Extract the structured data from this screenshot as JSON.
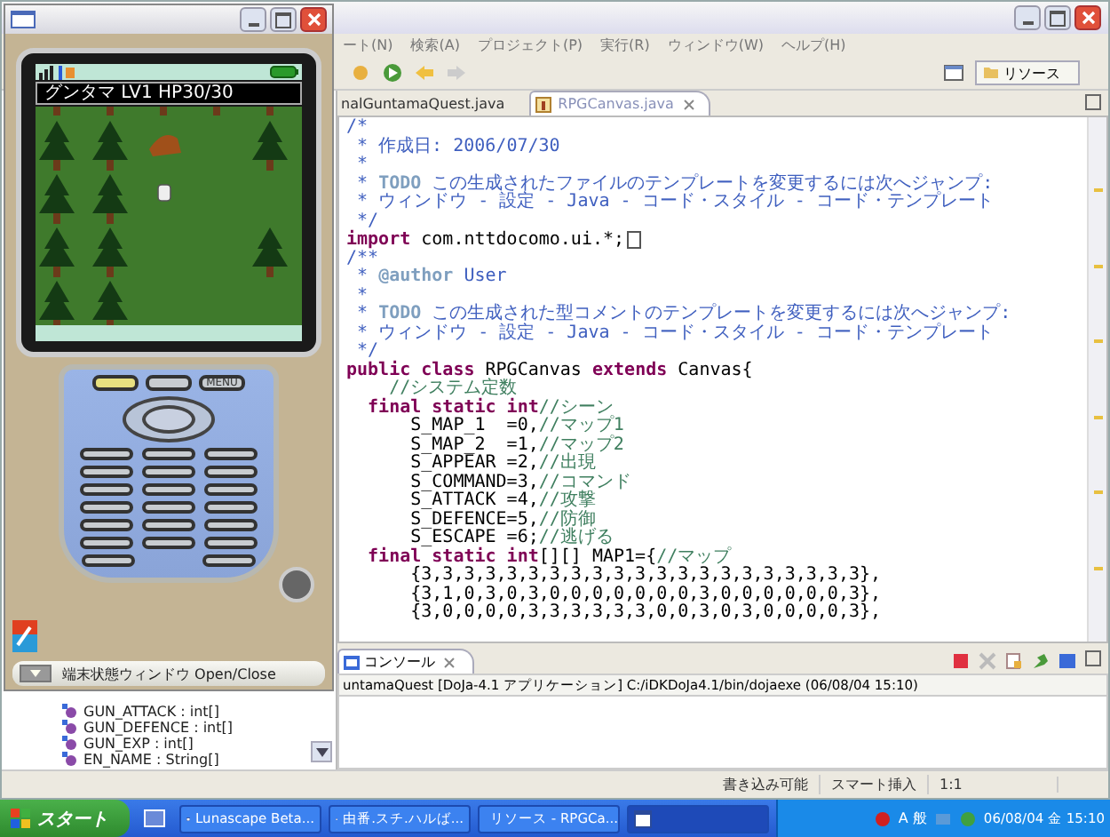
{
  "eclipse": {
    "menu": [
      "ート(N)",
      "検索(A)",
      "プロジェクト(P)",
      "実行(R)",
      "ウィンドウ(W)",
      "ヘルプ(H)"
    ],
    "perspective": "リソース",
    "tabs": [
      {
        "label": "nalGuntamaQuest.java",
        "selected": false
      },
      {
        "label": "RPGCanvas.java",
        "selected": true
      }
    ],
    "code_lines": [
      {
        "parts": [
          {
            "kind": "doc",
            "text": "/*"
          }
        ]
      },
      {
        "parts": [
          {
            "kind": "doc",
            "text": " * 作成日: 2006/07/30"
          }
        ]
      },
      {
        "parts": [
          {
            "kind": "doc",
            "text": " *"
          }
        ]
      },
      {
        "parts": [
          {
            "kind": "doc",
            "text": " * "
          },
          {
            "kind": "tag",
            "text": "TODO"
          },
          {
            "kind": "doc",
            "text": " この生成されたファイルのテンプレートを変更するには次へジャンプ:"
          }
        ]
      },
      {
        "parts": [
          {
            "kind": "doc",
            "text": " * ウィンドウ - 設定 - Java - コード・スタイル - コード・テンプレート"
          }
        ]
      },
      {
        "parts": [
          {
            "kind": "doc",
            "text": " */"
          }
        ]
      },
      {
        "parts": [
          {
            "kind": "keyword",
            "text": "import"
          },
          {
            "kind": "plain",
            "text": " com.nttdocomo.ui.*;"
          }
        ],
        "folded": true
      },
      {
        "parts": [
          {
            "kind": "doc",
            "text": "/**"
          }
        ]
      },
      {
        "parts": [
          {
            "kind": "doc",
            "text": " * "
          },
          {
            "kind": "tag",
            "text": "@author"
          },
          {
            "kind": "doc",
            "text": " User"
          }
        ]
      },
      {
        "parts": [
          {
            "kind": "doc",
            "text": " *"
          }
        ]
      },
      {
        "parts": [
          {
            "kind": "doc",
            "text": " * "
          },
          {
            "kind": "tag",
            "text": "TODO"
          },
          {
            "kind": "doc",
            "text": " この生成された型コメントのテンプレートを変更するには次へジャンプ:"
          }
        ]
      },
      {
        "parts": [
          {
            "kind": "doc",
            "text": " * ウィンドウ - 設定 - Java - コード・スタイル - コード・テンプレート"
          }
        ]
      },
      {
        "parts": [
          {
            "kind": "doc",
            "text": " */"
          }
        ]
      },
      {
        "parts": [
          {
            "kind": "keyword",
            "text": "public class"
          },
          {
            "kind": "plain",
            "text": " RPGCanvas "
          },
          {
            "kind": "keyword",
            "text": "extends"
          },
          {
            "kind": "plain",
            "text": " Canvas{"
          }
        ]
      },
      {
        "parts": [
          {
            "kind": "comment",
            "text": "    //システム定数"
          }
        ]
      },
      {
        "parts": [
          {
            "kind": "keyword",
            "text": "  final static int"
          },
          {
            "kind": "comment",
            "text": "//シーン"
          }
        ]
      },
      {
        "parts": [
          {
            "kind": "plain",
            "text": "      S_MAP_1  =0,"
          },
          {
            "kind": "comment",
            "text": "//マップ1"
          }
        ]
      },
      {
        "parts": [
          {
            "kind": "plain",
            "text": "      S_MAP_2  =1,"
          },
          {
            "kind": "comment",
            "text": "//マップ2"
          }
        ]
      },
      {
        "parts": [
          {
            "kind": "plain",
            "text": "      S_APPEAR =2,"
          },
          {
            "kind": "comment",
            "text": "//出現"
          }
        ]
      },
      {
        "parts": [
          {
            "kind": "plain",
            "text": "      S_COMMAND=3,"
          },
          {
            "kind": "comment",
            "text": "//コマンド"
          }
        ]
      },
      {
        "parts": [
          {
            "kind": "plain",
            "text": "      S_ATTACK =4,"
          },
          {
            "kind": "comment",
            "text": "//攻撃"
          }
        ]
      },
      {
        "parts": [
          {
            "kind": "plain",
            "text": "      S_DEFENCE=5,"
          },
          {
            "kind": "comment",
            "text": "//防御"
          }
        ]
      },
      {
        "parts": [
          {
            "kind": "plain",
            "text": "      S_ESCAPE =6;"
          },
          {
            "kind": "comment",
            "text": "//逃げる"
          }
        ]
      },
      {
        "parts": [
          {
            "kind": "keyword",
            "text": "  final static int"
          },
          {
            "kind": "plain",
            "text": "[][] MAP1={"
          },
          {
            "kind": "comment",
            "text": "//マップ"
          }
        ]
      },
      {
        "parts": [
          {
            "kind": "plain",
            "text": "      {3,3,3,3,3,3,3,3,3,3,3,3,3,3,3,3,3,3,3,3,3},"
          }
        ]
      },
      {
        "parts": [
          {
            "kind": "plain",
            "text": "      {3,1,0,3,0,3,0,0,0,0,0,0,0,3,0,0,0,0,0,0,3},"
          }
        ]
      },
      {
        "parts": [
          {
            "kind": "plain",
            "text": "      {3,0,0,0,0,3,3,3,3,3,3,0,0,3,0,3,0,0,0,0,3},"
          }
        ]
      }
    ],
    "console": {
      "tab": "コンソール",
      "header": "untamaQuest [DoJa-4.1 アプリケーション] C:/iDKDoJa4.1/bin/dojaexe (06/08/04 15:10)"
    },
    "outline": [
      "GUN_ATTACK : int[]",
      "GUN_DEFENCE : int[]",
      "GUN_EXP : int[]",
      "EN_NAME : String[]"
    ],
    "status_bar": [
      "書き込み可能",
      "スマート挿入",
      "1:1"
    ]
  },
  "emulator": {
    "status_text": "グンタマ LV1 HP30/30",
    "menu_key": "MENU",
    "bottom_bar": "端末状態ウィンドウ Open/Close"
  },
  "taskbar": {
    "start": "スタート",
    "items": [
      {
        "label": "Lunascape Beta...",
        "selected": false
      },
      {
        "label": "由番.スチ.ハルば...",
        "selected": false
      },
      {
        "label": "リソース - RPGCa...",
        "selected": false
      },
      {
        "selected": true
      }
    ],
    "ime": "A 般",
    "clock": "06/08/04 金 15:10"
  }
}
